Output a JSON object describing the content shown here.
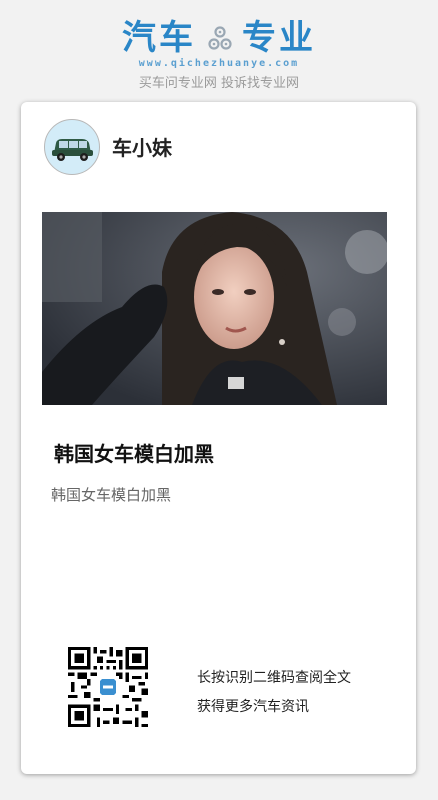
{
  "header": {
    "logo_left": "汽车",
    "logo_right": "专业",
    "site_url": "www.qichezhuanye.com",
    "slogan": "买车问专业网 投诉找专业网",
    "brand_color": "#2a86c7"
  },
  "card": {
    "author_name": "车小妹",
    "avatar_icon": "car-icon",
    "image_icon": "photo",
    "title": "韩国女车模白加黑",
    "summary": "韩国女车模白加黑",
    "qr_hint_line1": "长按识别二维码查阅全文",
    "qr_hint_line2": "获得更多汽车资讯"
  }
}
